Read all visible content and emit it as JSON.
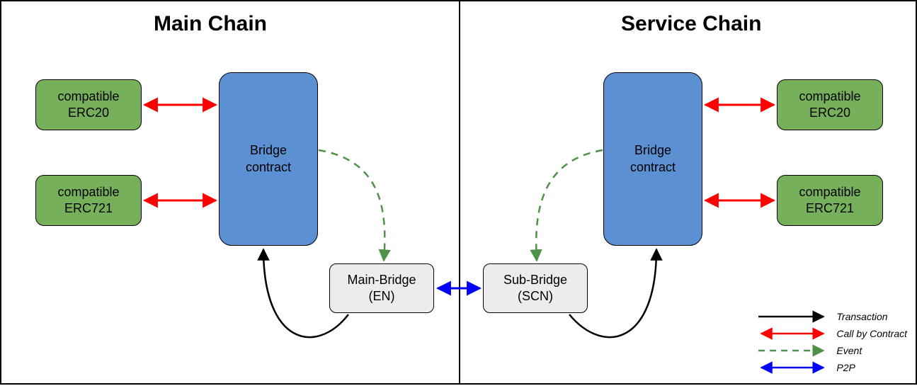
{
  "titles": {
    "left": "Main Chain",
    "right": "Service Chain"
  },
  "nodes": {
    "left_erc20": "compatible\nERC20",
    "left_erc721": "compatible\nERC721",
    "left_bridge_contract": "Bridge\ncontract",
    "left_main_bridge": "Main-Bridge\n(EN)",
    "right_sub_bridge": "Sub-Bridge\n(SCN)",
    "right_bridge_contract": "Bridge\ncontract",
    "right_erc20": "compatible\nERC20",
    "right_erc721": "compatible\nERC721"
  },
  "legend": {
    "transaction": "Transaction",
    "call_by_contract": "Call by Contract",
    "event": "Event",
    "p2p": "P2P"
  },
  "colors": {
    "red": "#ff0000",
    "green_arrow": "#4f9148",
    "blue_arrow": "#0000ff",
    "black": "#000000"
  }
}
